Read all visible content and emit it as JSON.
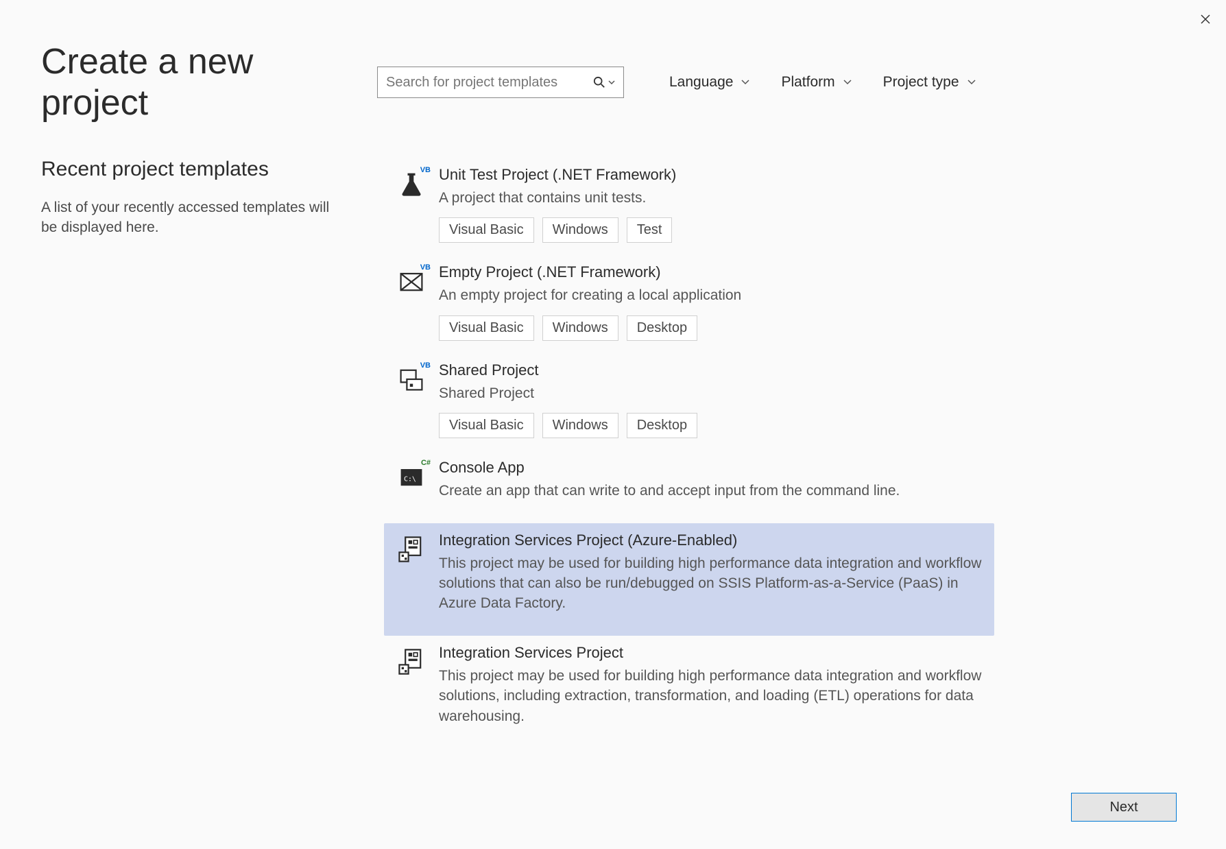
{
  "header": {
    "title": "Create a new project",
    "search_placeholder": "Search for project templates"
  },
  "filters": {
    "language": "Language",
    "platform": "Platform",
    "project_type": "Project type"
  },
  "recent": {
    "title": "Recent project templates",
    "description": "A list of your recently accessed templates will be displayed here."
  },
  "templates": [
    {
      "title": "Unit Test Project (.NET Framework)",
      "desc": "A project that contains unit tests.",
      "tags": [
        "Visual Basic",
        "Windows",
        "Test"
      ],
      "icon": "flask-vb",
      "selected": false
    },
    {
      "title": "Empty Project (.NET Framework)",
      "desc": "An empty project for creating a local application",
      "tags": [
        "Visual Basic",
        "Windows",
        "Desktop"
      ],
      "icon": "empty-vb",
      "selected": false
    },
    {
      "title": "Shared Project",
      "desc": "Shared Project",
      "tags": [
        "Visual Basic",
        "Windows",
        "Desktop"
      ],
      "icon": "shared-vb",
      "selected": false
    },
    {
      "title": "Console App",
      "desc": "Create an app that can write to and accept input from the command line.",
      "tags": [],
      "icon": "console-cs",
      "selected": false
    },
    {
      "title": "Integration Services Project (Azure-Enabled)",
      "desc": "This project may be used for building high performance data integration and workflow solutions that can also be run/debugged on SSIS Platform-as-a-Service (PaaS) in Azure Data Factory.",
      "tags": [],
      "icon": "ssis",
      "selected": true
    },
    {
      "title": "Integration Services Project",
      "desc": "This project may be used for building high performance data integration and workflow solutions, including extraction, transformation, and loading (ETL) operations for data warehousing.",
      "tags": [],
      "icon": "ssis",
      "selected": false
    }
  ],
  "footer": {
    "next": "Next"
  }
}
